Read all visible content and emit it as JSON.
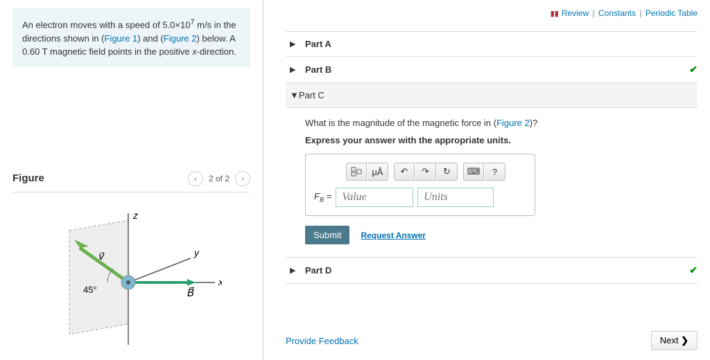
{
  "problem": {
    "text_pre": "An electron moves with a speed of ",
    "value": "5.0×10",
    "exp": "7",
    "unit_speed": " m/s",
    "text_mid": " in the directions shown in (",
    "fig1": "Figure 1",
    "text_mid2": ") and (",
    "fig2": "Figure 2",
    "text_mid3": ") below. A 0.60 T magnetic field points in the positive ",
    "xsym": "x",
    "text_end": "-direction."
  },
  "figure": {
    "title": "Figure",
    "pager": "2 of 2",
    "labels": {
      "z": "z",
      "y": "y",
      "x": "x",
      "v": "v⃗",
      "B": "B⃗",
      "angle": "45°"
    }
  },
  "topLinks": {
    "review": "Review",
    "constants": "Constants",
    "periodic": "Periodic Table"
  },
  "parts": {
    "A": {
      "label": "Part A"
    },
    "B": {
      "label": "Part B"
    },
    "C": {
      "label": "Part C",
      "question_pre": "What is the magnitude of the magnetic force in (",
      "question_link": "Figure 2",
      "question_post": ")?",
      "instruction": "Express your answer with the appropriate units.",
      "fb_symbol": "F",
      "fb_sub": "B",
      "equals": " = ",
      "value_ph": "Value",
      "units_ph": "Units",
      "toolbar": {
        "units_btn": "μÅ",
        "help": "?"
      },
      "submit": "Submit",
      "request": "Request Answer"
    },
    "D": {
      "label": "Part D"
    }
  },
  "feedback": "Provide Feedback",
  "next": "Next"
}
